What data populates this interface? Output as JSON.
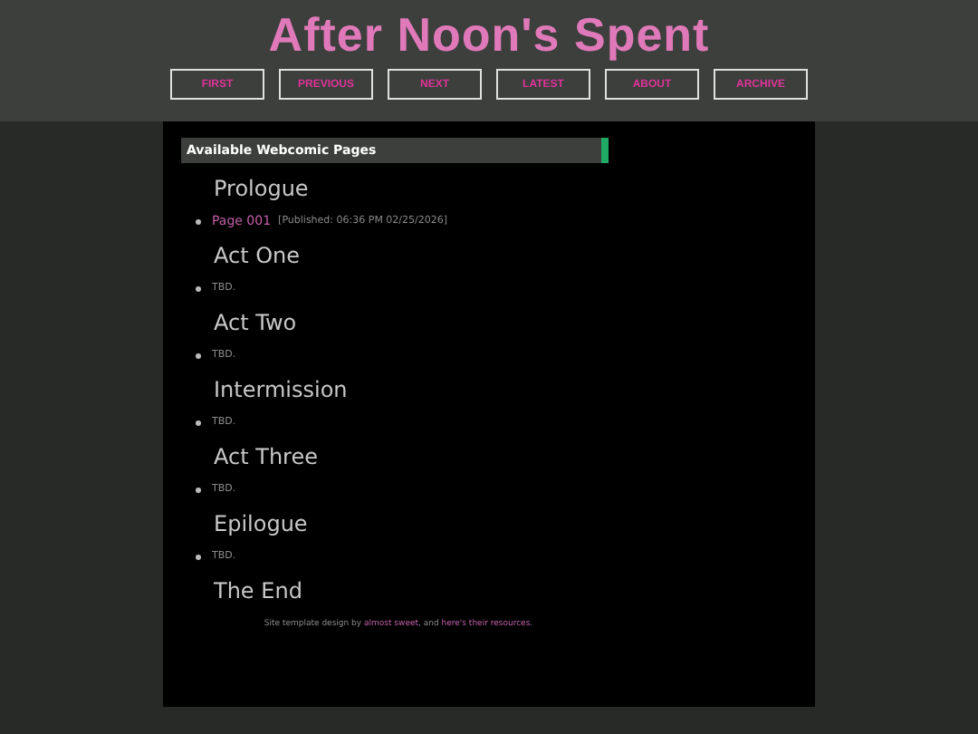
{
  "site_title": "After Noon's Spent",
  "nav": [
    "FIRST",
    "PREVIOUS",
    "NEXT",
    "LATEST",
    "ABOUT",
    "ARCHIVE"
  ],
  "panel_title": "Available Webcomic Pages",
  "sections": [
    {
      "heading": "Prologue",
      "items": [
        {
          "kind": "link",
          "label": "Page 001",
          "meta": "[Published: 06:36 PM 02/25/2026]"
        }
      ]
    },
    {
      "heading": "Act One",
      "items": [
        {
          "kind": "text",
          "label": "TBD."
        }
      ]
    },
    {
      "heading": "Act Two",
      "items": [
        {
          "kind": "text",
          "label": "TBD."
        }
      ]
    },
    {
      "heading": "Intermission",
      "items": [
        {
          "kind": "text",
          "label": "TBD."
        }
      ]
    },
    {
      "heading": "Act Three",
      "items": [
        {
          "kind": "text",
          "label": "TBD."
        }
      ]
    },
    {
      "heading": "Epilogue",
      "items": [
        {
          "kind": "text",
          "label": "TBD."
        }
      ]
    },
    {
      "heading": "The End"
    }
  ],
  "footer": [
    {
      "kind": "text",
      "text": "Site template design by "
    },
    {
      "kind": "link",
      "text": "almost sweet"
    },
    {
      "kind": "text",
      "text": ", and "
    },
    {
      "kind": "link",
      "text": "here's their resources"
    },
    {
      "kind": "text",
      "text": "."
    }
  ]
}
